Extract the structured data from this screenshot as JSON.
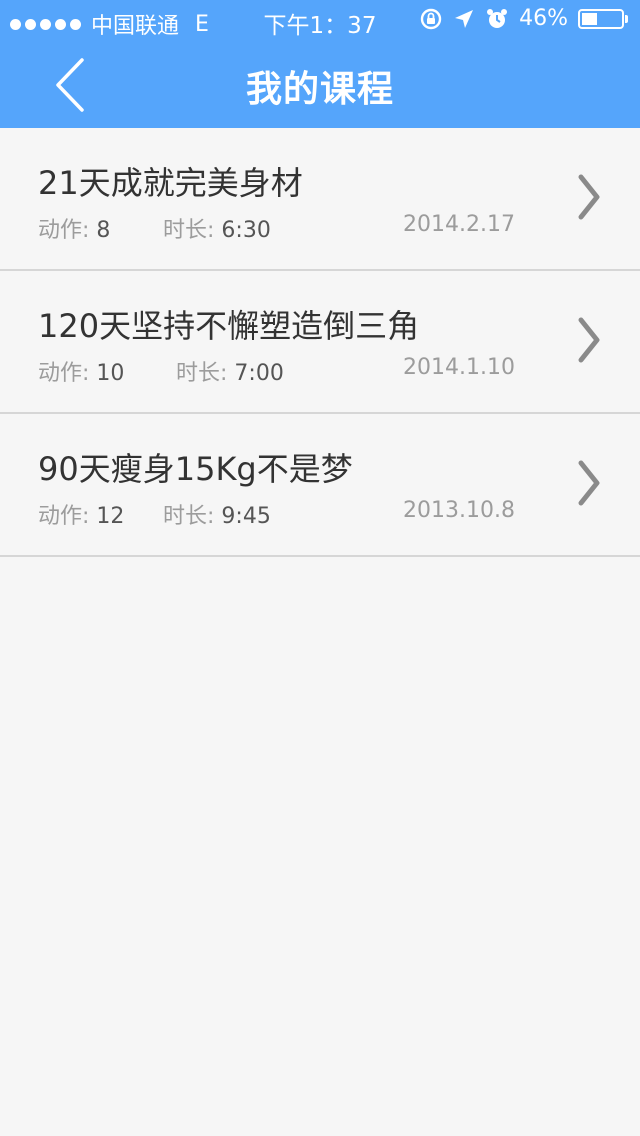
{
  "status_bar": {
    "carrier": "中国联通",
    "network": "E",
    "time": "下午1：37",
    "battery_percent": "46%",
    "battery_level": 0.46,
    "icons": [
      "signal-dots-icon",
      "rotation-lock-icon",
      "location-arrow-icon",
      "alarm-clock-icon",
      "battery-icon"
    ]
  },
  "header": {
    "title": "我的课程",
    "back_icon": "chevron-left-icon",
    "background": "#55a5fb"
  },
  "courses": [
    {
      "title": "21天成就完美身材",
      "actions_label": "动作: ",
      "actions_value": "8",
      "duration_label": "时长: ",
      "duration_value": "6:30",
      "date": "2014.2.17"
    },
    {
      "title": "120天坚持不懈塑造倒三角",
      "actions_label": "动作: ",
      "actions_value": "10",
      "duration_label": "时长: ",
      "duration_value": "7:00",
      "date": "2014.1.10"
    },
    {
      "title": "90天瘦身15Kg不是梦",
      "actions_label": "动作: ",
      "actions_value": "12",
      "duration_label": "时长: ",
      "duration_value": "9:45",
      "date": "2013.10.8"
    }
  ]
}
